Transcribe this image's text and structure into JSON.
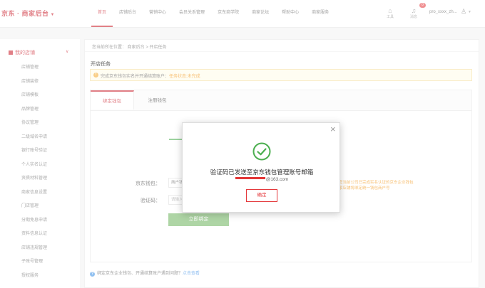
{
  "header": {
    "logo": "京东 · 商家后台",
    "nav": [
      "首页",
      "店铺后台",
      "营销中心",
      "会员关系管理",
      "京东商学院",
      "商家论坛",
      "帮助中心",
      "商家服务"
    ],
    "icon_labels": [
      "工具",
      "消息"
    ],
    "message_count": "0",
    "user_name": "pro_xxxx_zh..."
  },
  "sidebar": {
    "heading": "我的店铺",
    "items": [
      "店铺管理",
      "店铺装修",
      "店铺模板",
      "品牌管理",
      "协议管理",
      "二级域名申请",
      "银行账号验证",
      "个人实名认证",
      "资质材料管理",
      "商家信息设置",
      "门店管理",
      "分期免息申请",
      "资料信息认证",
      "店铺违规管理",
      "子账号管理",
      "授权服务"
    ]
  },
  "main": {
    "breadcrumb": "您当前所在位置：  商家后台  >  开店任务",
    "title": "开店任务",
    "notice_text": "完成京东钱包实名并开通结算账户：",
    "notice_status": "任务状态:未完成",
    "tabs": [
      "绑定钱包",
      "注册钱包"
    ],
    "form": {
      "wallet_label": "京东钱包：",
      "wallet_value": "商户钱包",
      "code_label": "验证码：",
      "code_placeholder": "请输入",
      "submit": "立即绑定",
      "tips": [
        "输入您当前公司已完成实名认证的京东企业钱包",
        "开多家店铺将绑定统一钱包商户号"
      ]
    },
    "help_text": "绑定京东企业钱包、开通结算账户遇到问题？",
    "help_link": "点击查看"
  },
  "modal": {
    "title": "验证码已发送至京东钱包管理账号邮箱",
    "email_suffix": "@163.com",
    "ok": "确定"
  },
  "colors": {
    "brand": "#c81623",
    "success": "#4caf50",
    "button": "#6cb35c",
    "warning": "#f08c00"
  }
}
